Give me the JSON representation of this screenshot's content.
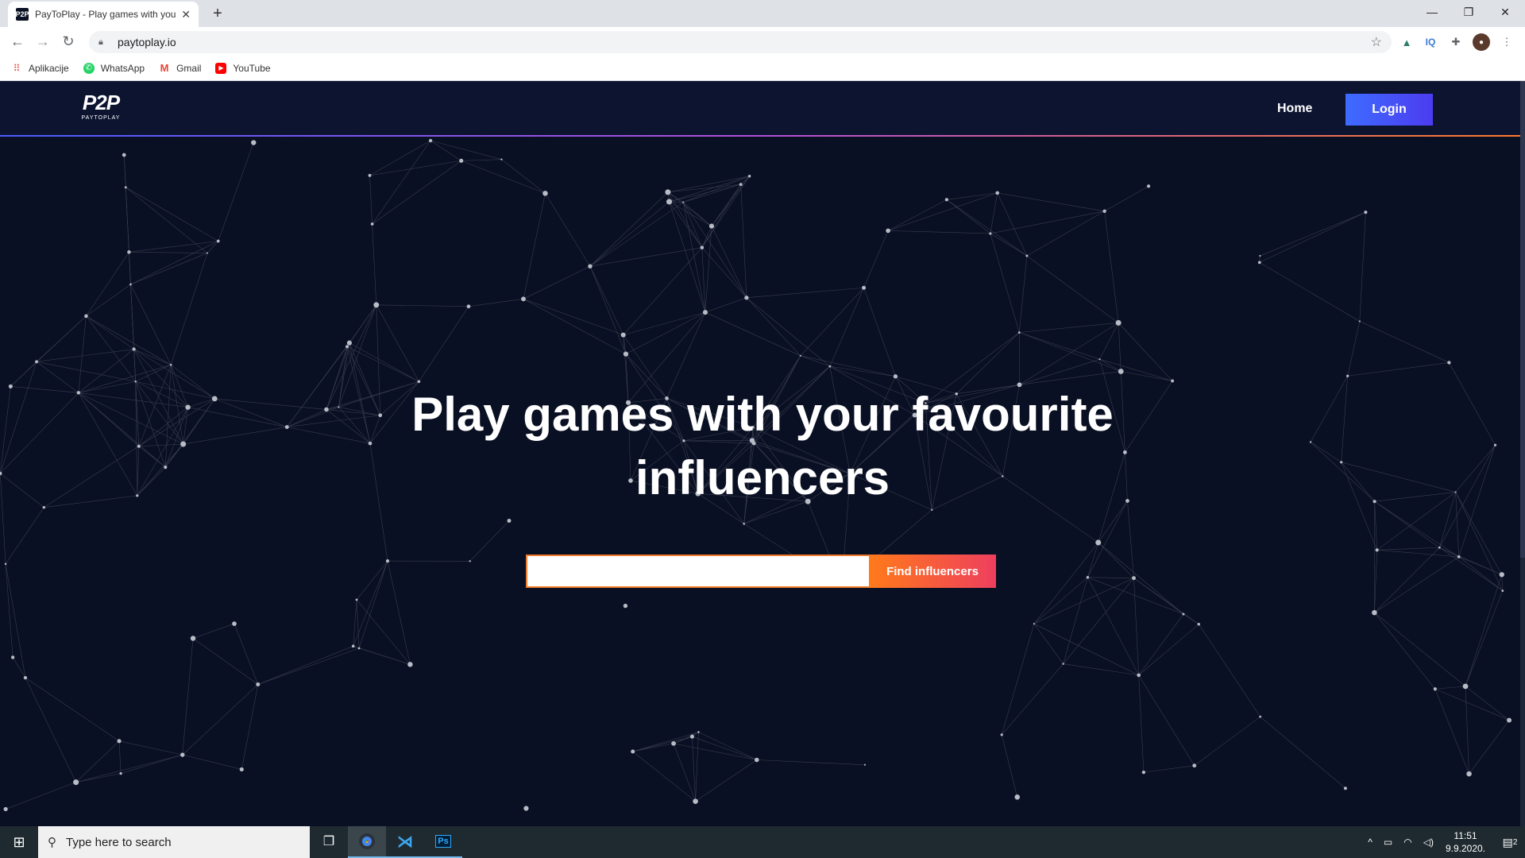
{
  "browser": {
    "tab_title": "PayToPlay - Play games with your favourite influencers",
    "tab_favicon": "P2P",
    "url": "paytoplay.io",
    "bookmarks": [
      {
        "label": "Aplikacije",
        "icon": "apps-grid-icon",
        "color": "#ea4335"
      },
      {
        "label": "WhatsApp",
        "icon": "whatsapp-icon",
        "color": "#25d366"
      },
      {
        "label": "Gmail",
        "icon": "gmail-icon",
        "color": "#ea4335"
      },
      {
        "label": "YouTube",
        "icon": "youtube-icon",
        "color": "#ff0000"
      }
    ]
  },
  "site": {
    "logo_mark": "P2P",
    "logo_word": "PAYTOPLAY",
    "nav_home": "Home",
    "nav_login": "Login",
    "hero_title": "Play games with your favourite influencers",
    "search_placeholder": "",
    "search_button": "Find influencers",
    "accent_colors": {
      "login": "#4a5bff",
      "search": "#f27b2b",
      "search_end": "#ee3f5e"
    }
  },
  "taskbar": {
    "search_placeholder": "Type here to search",
    "time": "11:51",
    "date": "9.9.2020.",
    "notifications": "2"
  }
}
